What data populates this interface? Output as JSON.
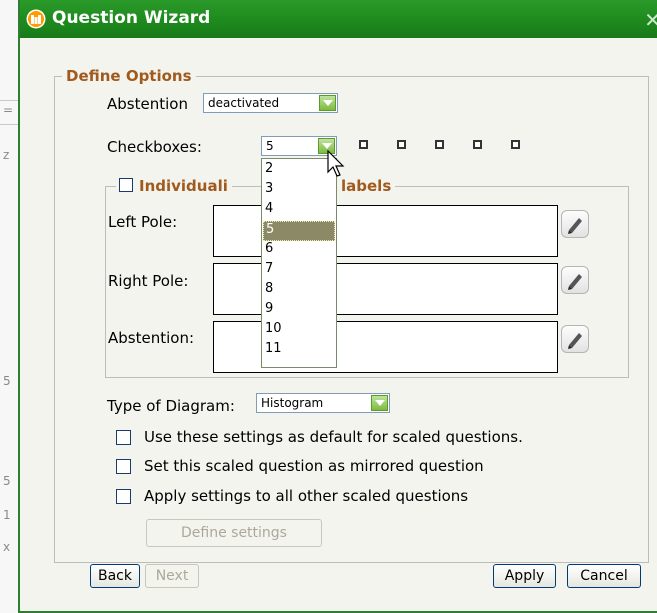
{
  "window": {
    "title": "Question Wizard",
    "close_glyph": "✕"
  },
  "define_options": {
    "legend": "Define Options",
    "abstention": {
      "label": "Abstention",
      "value": "deactivated"
    },
    "checkboxes": {
      "label": "Checkboxes:",
      "value": "5",
      "options": [
        "2",
        "3",
        "4",
        "5",
        "6",
        "7",
        "8",
        "9",
        "10",
        "11"
      ],
      "selected_index": 3
    },
    "individual_labels": {
      "legend_visible_left": "Individuali",
      "legend_visible_right": "labels",
      "left_pole": "Left Pole:",
      "right_pole": "Right Pole:",
      "abstention": "Abstention:"
    },
    "type_of_diagram": {
      "label": "Type of Diagram:",
      "value": "Histogram"
    },
    "options": [
      {
        "label": "Use these settings as default for scaled questions.",
        "checked": false
      },
      {
        "label": "Set this scaled question as mirrored question",
        "checked": false
      },
      {
        "label": "Apply settings to all other scaled questions",
        "checked": false
      }
    ],
    "define_settings_button": "Define settings"
  },
  "footer": {
    "back": "Back",
    "next": "Next",
    "apply": "Apply",
    "cancel": "Cancel"
  },
  "colors": {
    "titlebar": "#1e8a1e",
    "legend": "#a05a1e",
    "selected_option": "#8c8a66"
  },
  "background_left_chars": [
    "=",
    "z",
    "5",
    "5",
    "1",
    "x"
  ]
}
